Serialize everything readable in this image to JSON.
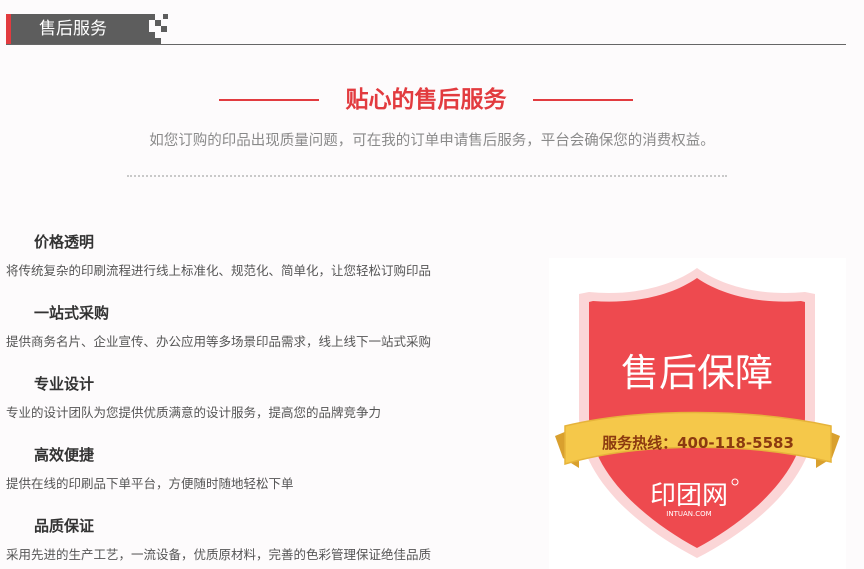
{
  "tab": {
    "label": "售后服务"
  },
  "headline": {
    "title": "贴心的售后服务",
    "subtitle": "如您订购的印品出现质量问题，可在我的订单申请售后服务，平台会确保您的消费权益。"
  },
  "features": [
    {
      "title": "价格透明",
      "desc": "将传统复杂的印刷流程进行线上标准化、规范化、简单化，让您轻松订购印品"
    },
    {
      "title": "一站式采购",
      "desc": "提供商务名片、企业宣传、办公应用等多场景印品需求，线上线下一站式采购"
    },
    {
      "title": "专业设计",
      "desc": "专业的设计团队为您提供优质满意的设计服务，提高您的品牌竞争力"
    },
    {
      "title": "高效便捷",
      "desc": "提供在线的印刷品下单平台，方便随时随地轻松下单"
    },
    {
      "title": "品质保证",
      "desc": "采用先进的生产工艺，一流设备，优质原材料，完善的色彩管理保证绝佳品质"
    }
  ],
  "badge": {
    "title": "售后保障",
    "hotline": "服务热线：400-118-5583",
    "brand": "印团网",
    "brand_domain": "INTUAN.COM",
    "colors": {
      "shield": "#ee4a4f",
      "ribbon": "#f5c84a",
      "ribbon_text": "#8b3a10"
    }
  },
  "colors": {
    "accent": "#e23b3f",
    "tab_bg": "#5d5d5d"
  }
}
